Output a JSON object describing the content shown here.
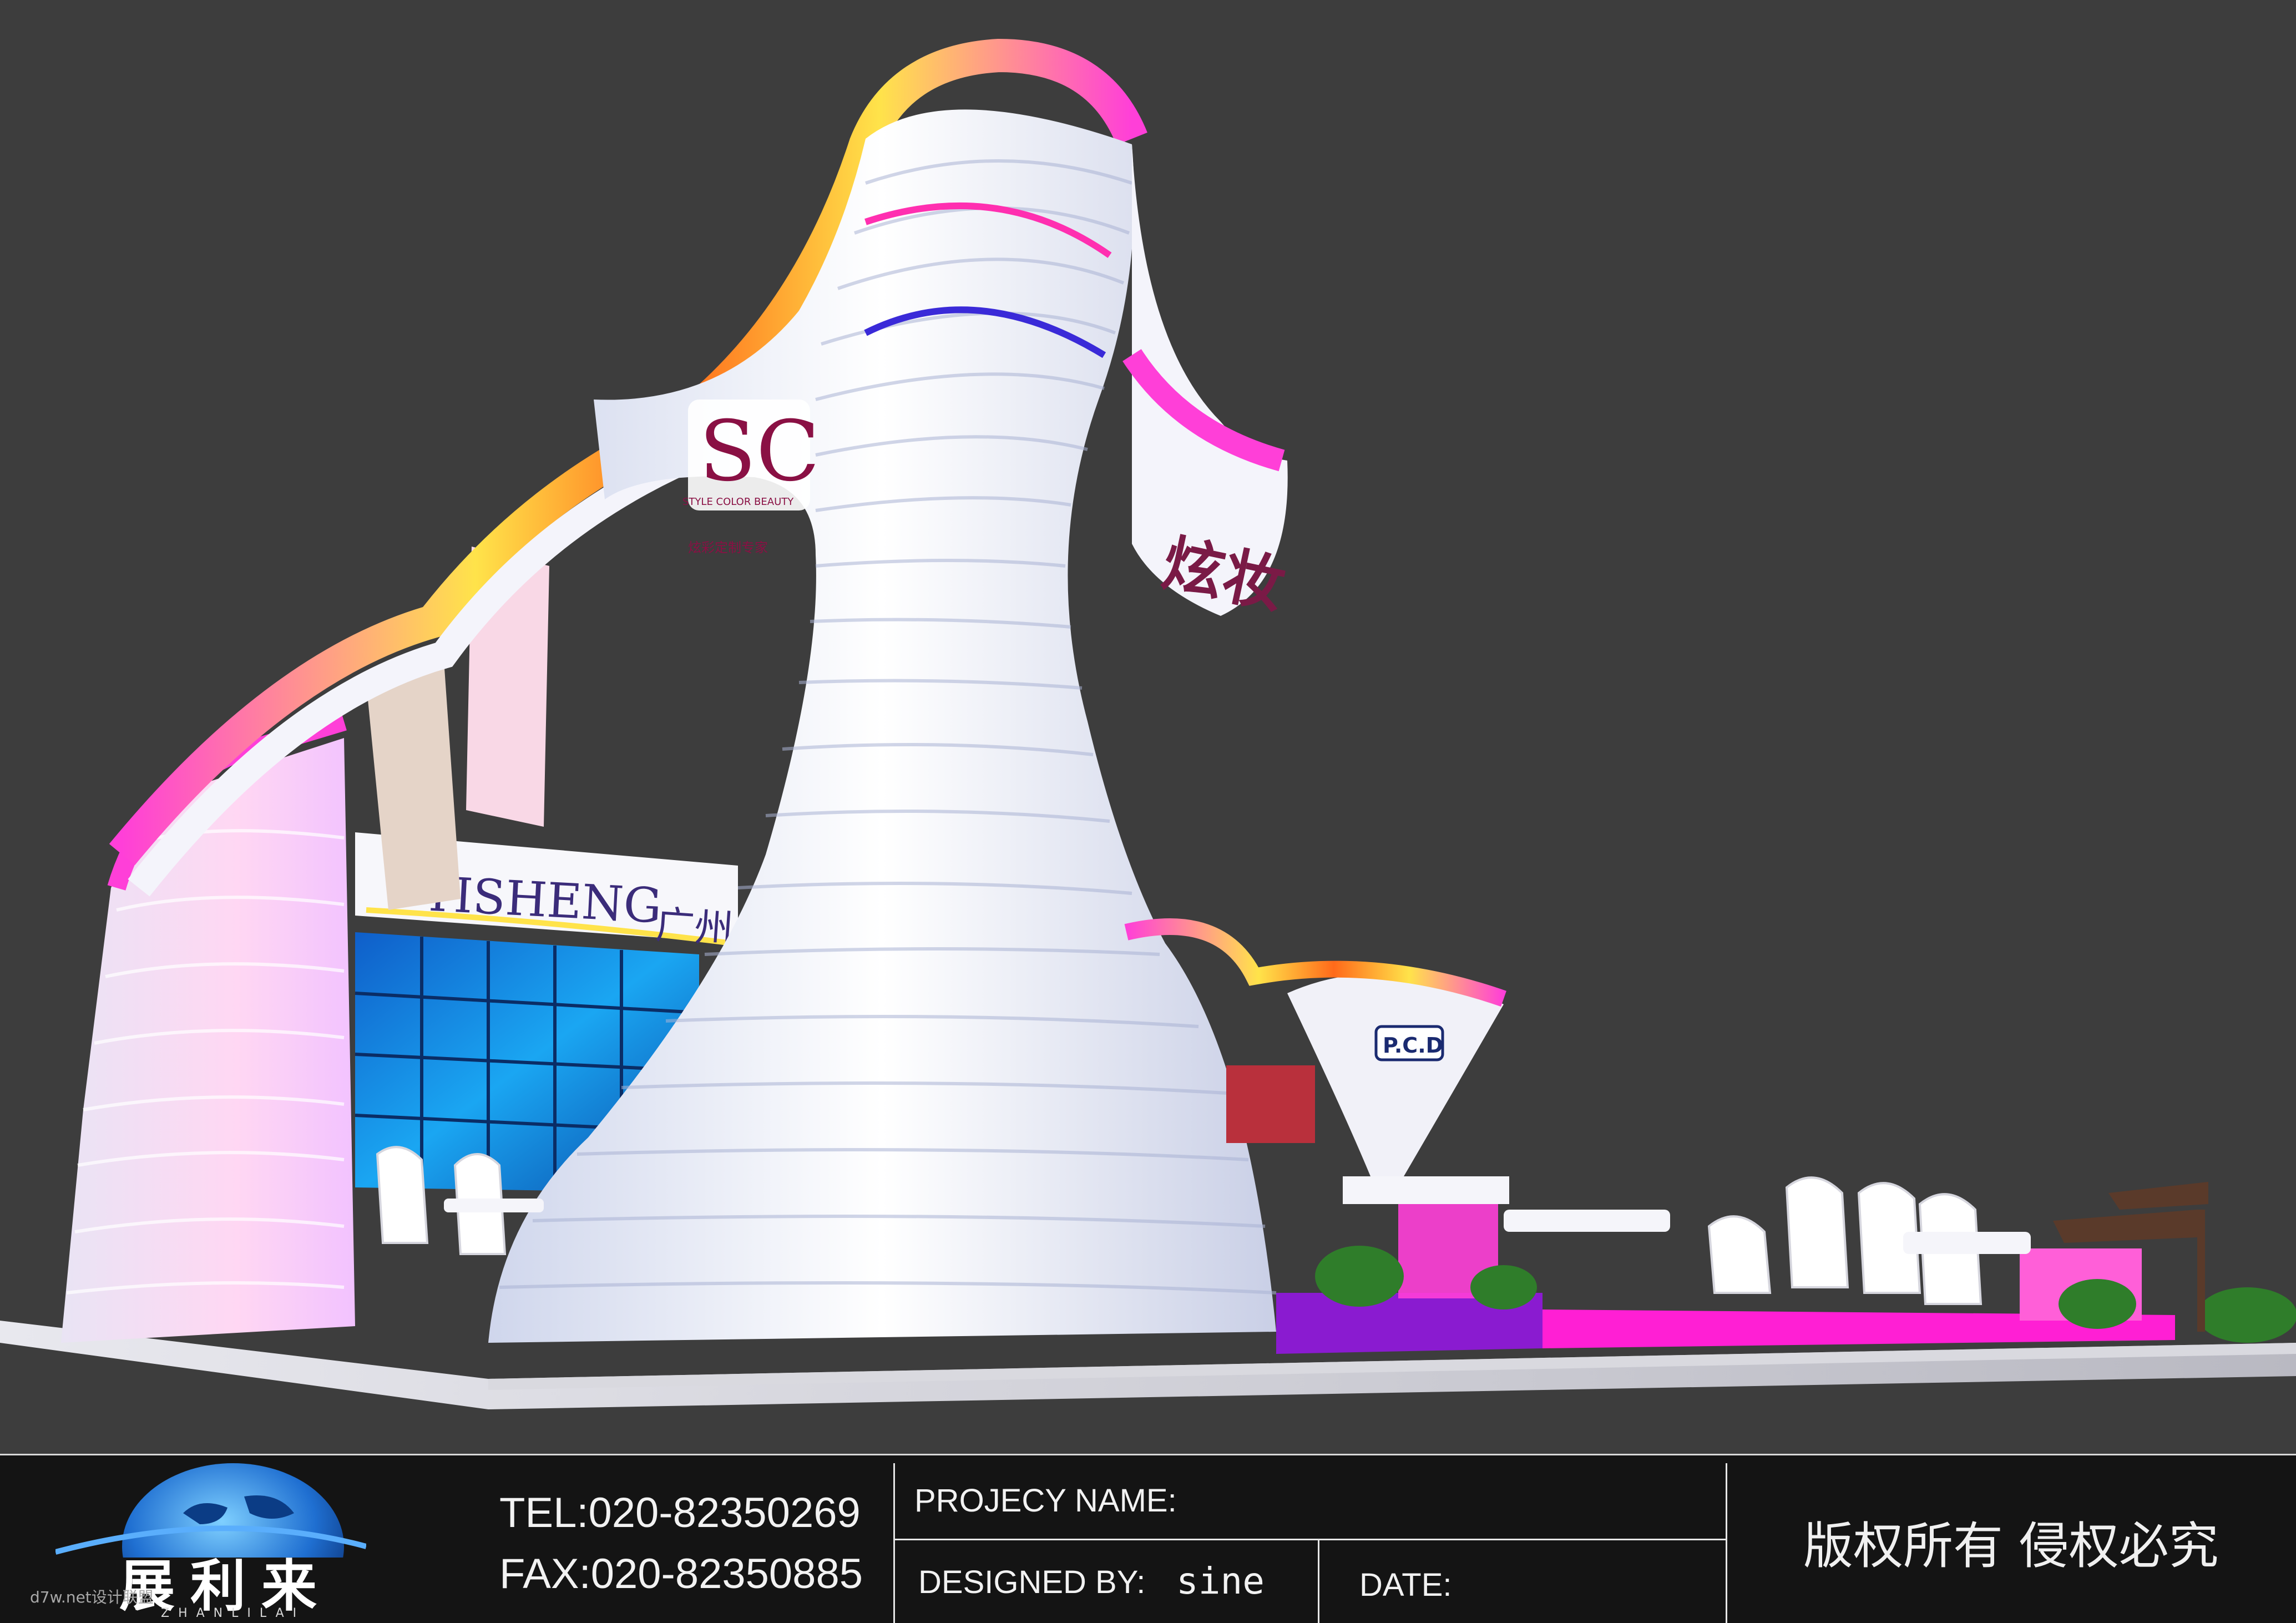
{
  "booth": {
    "brand_sign": "YISHENG",
    "brand_sign_cn": "广州",
    "top_logo": {
      "mark": "SC",
      "caption": "STYLE COLOR BEAUTY",
      "caption_cn": "炫彩定制专家"
    },
    "side_logo": "炫妆",
    "small_logo": "P.C.D"
  },
  "colors": {
    "background": "#3d3d3d",
    "titleblock": "#141414",
    "structure": "#eef0f8",
    "neon_pink": "#ff3fd8",
    "neon_orange": "#ff6a1a",
    "neon_yellow": "#ffe34a",
    "floor_magenta": "#ff1fd4",
    "floor_purple": "#8a1bd0"
  },
  "titleblock": {
    "logo_cn": "展利来",
    "logo_en": "ZHANLILAI",
    "tel": "TEL:020-82350269",
    "fax": "FAX:020-82350885",
    "project_name_label": "PROJECY NAME:",
    "designed_by_label": "DESIGNED BY:",
    "designed_by_value": "sine",
    "date_label": "DATE:",
    "copyright": "版权所有 侵权必究",
    "watermark": "d7w.net设计联盟"
  }
}
